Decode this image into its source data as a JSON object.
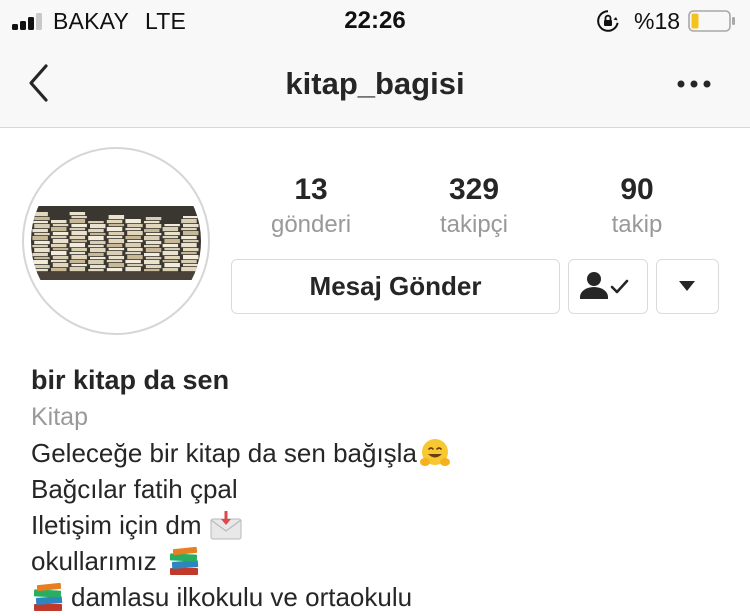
{
  "status_bar": {
    "carrier": "BAKAY",
    "network": "LTE",
    "time": "22:26",
    "battery_percent": "%18",
    "battery_level": 0.18,
    "colors": {
      "battery_fill": "#f5c31c"
    }
  },
  "nav": {
    "title": "kitap_bagisi",
    "back_icon": "chevron-left-icon",
    "more_icon": "ellipsis-icon"
  },
  "profile": {
    "avatar_icon": "stacked-books-photo",
    "stats": [
      {
        "value": "13",
        "label": "gönderi"
      },
      {
        "value": "329",
        "label": "takipçi"
      },
      {
        "value": "90",
        "label": "takip"
      }
    ],
    "message_button_label": "Mesaj Gönder",
    "following_icon": "person-check-icon",
    "dropdown_icon": "triangle-down-icon"
  },
  "bio": {
    "name": "bir kitap da sen",
    "category": "Kitap",
    "lines": [
      {
        "text": "Geleceğe bir kitap da sen bağışla",
        "emoji_after": "hugging-face-emoji"
      },
      {
        "text": "Bağcılar fatih çpal"
      },
      {
        "text": "Iletişim için dm",
        "emoji_after": "envelope-with-arrow-emoji"
      },
      {
        "text": "okullarımız",
        "emoji_after": "books-emoji"
      },
      {
        "text": "damlasu ilkokulu ve ortaokulu",
        "emoji_before": "books-emoji"
      }
    ]
  }
}
